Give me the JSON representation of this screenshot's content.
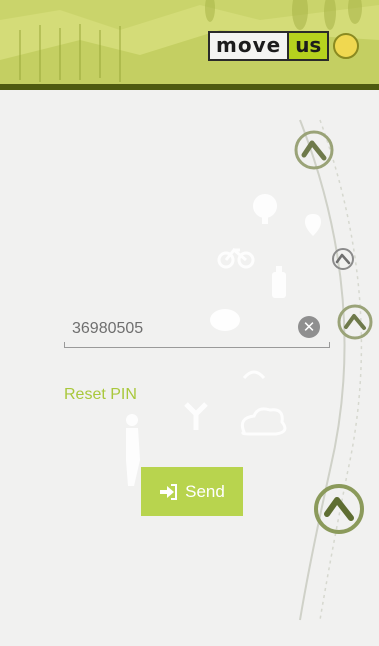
{
  "header": {
    "logo_move": "move",
    "logo_us": "us"
  },
  "form": {
    "pin_value": "36980505",
    "clear_icon": "✕",
    "reset_label": "Reset PIN",
    "send_label": "Send"
  },
  "colors": {
    "accent": "#b8d44e",
    "header_bar": "#4e5a10",
    "link": "#a9c83c",
    "background": "#f1f1f0"
  },
  "icons": [
    "clock-icon",
    "clear-icon",
    "send-arrow-icon",
    "chevron-up-icon",
    "tree-icon",
    "bicycle-icon",
    "scooter-icon",
    "location-pin-icon",
    "speech-bubble-icon",
    "cloud-icon",
    "road-split-icon",
    "pedestrian-icon"
  ]
}
